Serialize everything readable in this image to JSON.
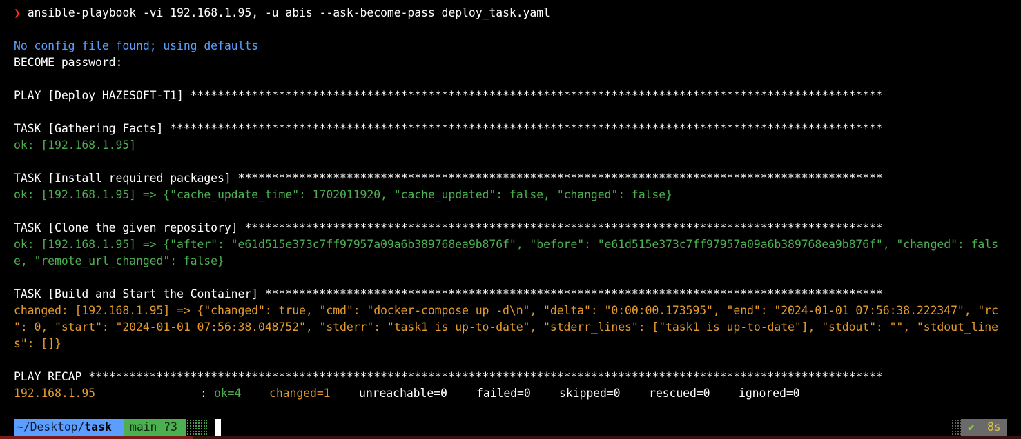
{
  "prompt": {
    "arrow": "❯",
    "command": "ansible-playbook -vi 192.168.1.95, -u abis --ask-become-pass deploy_task.yaml"
  },
  "output": {
    "no_config": "No config file found; using defaults",
    "become": "BECOME password:",
    "play": "PLAY [Deploy HAZESOFT-T1] ******************************************************************************************************",
    "task1": "TASK [Gathering Facts] *********************************************************************************************************",
    "task1_result": "ok: [192.168.1.95]",
    "task2": "TASK [Install required packages] ***********************************************************************************************",
    "task2_result": "ok: [192.168.1.95] => {\"cache_update_time\": 1702011920, \"cache_updated\": false, \"changed\": false}",
    "task3": "TASK [Clone the given repository] **********************************************************************************************",
    "task3_result_1": "ok: [192.168.1.95] => {\"after\": \"e61d515e373c7ff97957a09a6b389768ea9b876f\", \"before\": \"e61d515e373c7ff97957a09a6b389768ea9b876f\", \"changed\": fals",
    "task3_result_2": "e, \"remote_url_changed\": false}",
    "task4": "TASK [Build and Start the Container] *******************************************************************************************",
    "task4_result_1": "changed: [192.168.1.95] => {\"changed\": true, \"cmd\": \"docker-compose up -d\\n\", \"delta\": \"0:00:00.173595\", \"end\": \"2024-01-01 07:56:38.222347\", \"rc",
    "task4_result_2": "\": 0, \"start\": \"2024-01-01 07:56:38.048752\", \"stderr\": \"task1 is up-to-date\", \"stderr_lines\": [\"task1 is up-to-date\"], \"stdout\": \"\", \"stdout_line",
    "task4_result_3": "s\": []}",
    "recap": "PLAY RECAP *********************************************************************************************************************"
  },
  "recap_row": {
    "host": "192.168.1.95",
    "sep": ":",
    "ok": "ok=4",
    "changed": "changed=1",
    "unreachable": "unreachable=0",
    "failed": "failed=0",
    "skipped": "skipped=0",
    "rescued": "rescued=0",
    "ignored": "ignored=0"
  },
  "statusbar": {
    "path_prefix": "~/Desktop/",
    "path_dir": "task",
    "git": "main ?3",
    "check": "✔",
    "time": "8s"
  },
  "colors": {
    "ok": "#4caf50",
    "changed": "#e59b2b",
    "info": "#5c9eff",
    "prompt_arrow": "#ff3030",
    "path_segment": "#5c9eff",
    "git_segment": "#4caf50",
    "right_segment": "#6a6a6a"
  }
}
